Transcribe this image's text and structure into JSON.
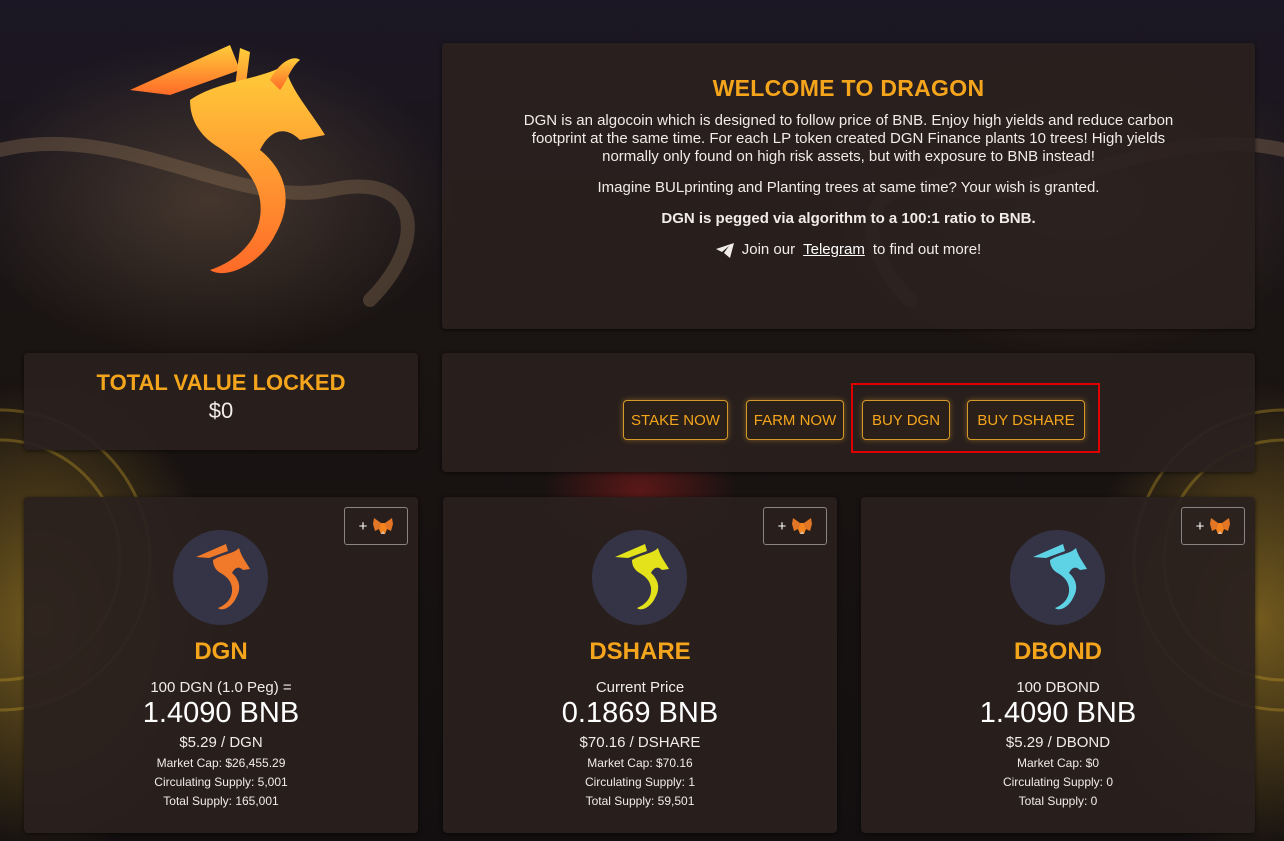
{
  "colors": {
    "accent": "#f4a51c",
    "card": "#2a201e",
    "highlight": "#e00000"
  },
  "welcome": {
    "title": "WELCOME TO DRAGON",
    "p1": "DGN is an algocoin which is designed to follow price of BNB. Enjoy high yields and reduce carbon footprint at the same time. For each LP token created DGN Finance plants 10 trees! High yields normally only found on high risk assets, but with exposure to BNB instead!",
    "p2": "Imagine BULprinting and Planting trees at same time? Your wish is granted.",
    "p3": "DGN is pegged via algorithm to a 100:1 ratio to BNB.",
    "telegram_icon": "paper-plane-icon",
    "telegram_pre": "Join our",
    "telegram_link": "Telegram",
    "telegram_post": "to find out more!"
  },
  "tvl": {
    "title": "TOTAL VALUE LOCKED",
    "value": "$0"
  },
  "actions": {
    "stake": "STAKE NOW",
    "farm": "FARM NOW",
    "buy_dgn": "BUY DGN",
    "buy_dshare": "BUY DSHARE"
  },
  "tokens": [
    {
      "add_label": "+",
      "wallet_icon": "metamask-fox-icon",
      "logo_color": "#f07a2a",
      "name": "DGN",
      "label": "100 DGN (1.0 Peg) =",
      "price": "1.4090 BNB",
      "usd": "$5.29 / DGN",
      "market_cap": "Market Cap: $26,455.29",
      "circulating": "Circulating Supply: 5,001",
      "total": "Total Supply: 165,001"
    },
    {
      "add_label": "+",
      "wallet_icon": "metamask-fox-icon",
      "logo_color": "#e4e21a",
      "name": "DSHARE",
      "label": "Current Price",
      "price": "0.1869 BNB",
      "usd": "$70.16 / DSHARE",
      "market_cap": "Market Cap: $70.16",
      "circulating": "Circulating Supply: 1",
      "total": "Total Supply: 59,501"
    },
    {
      "add_label": "+",
      "wallet_icon": "metamask-fox-icon",
      "logo_color": "#5fd3e6",
      "name": "DBOND",
      "label": "100 DBOND",
      "price": "1.4090 BNB",
      "usd": "$5.29 / DBOND",
      "market_cap": "Market Cap: $0",
      "circulating": "Circulating Supply: 0",
      "total": "Total Supply: 0"
    }
  ]
}
